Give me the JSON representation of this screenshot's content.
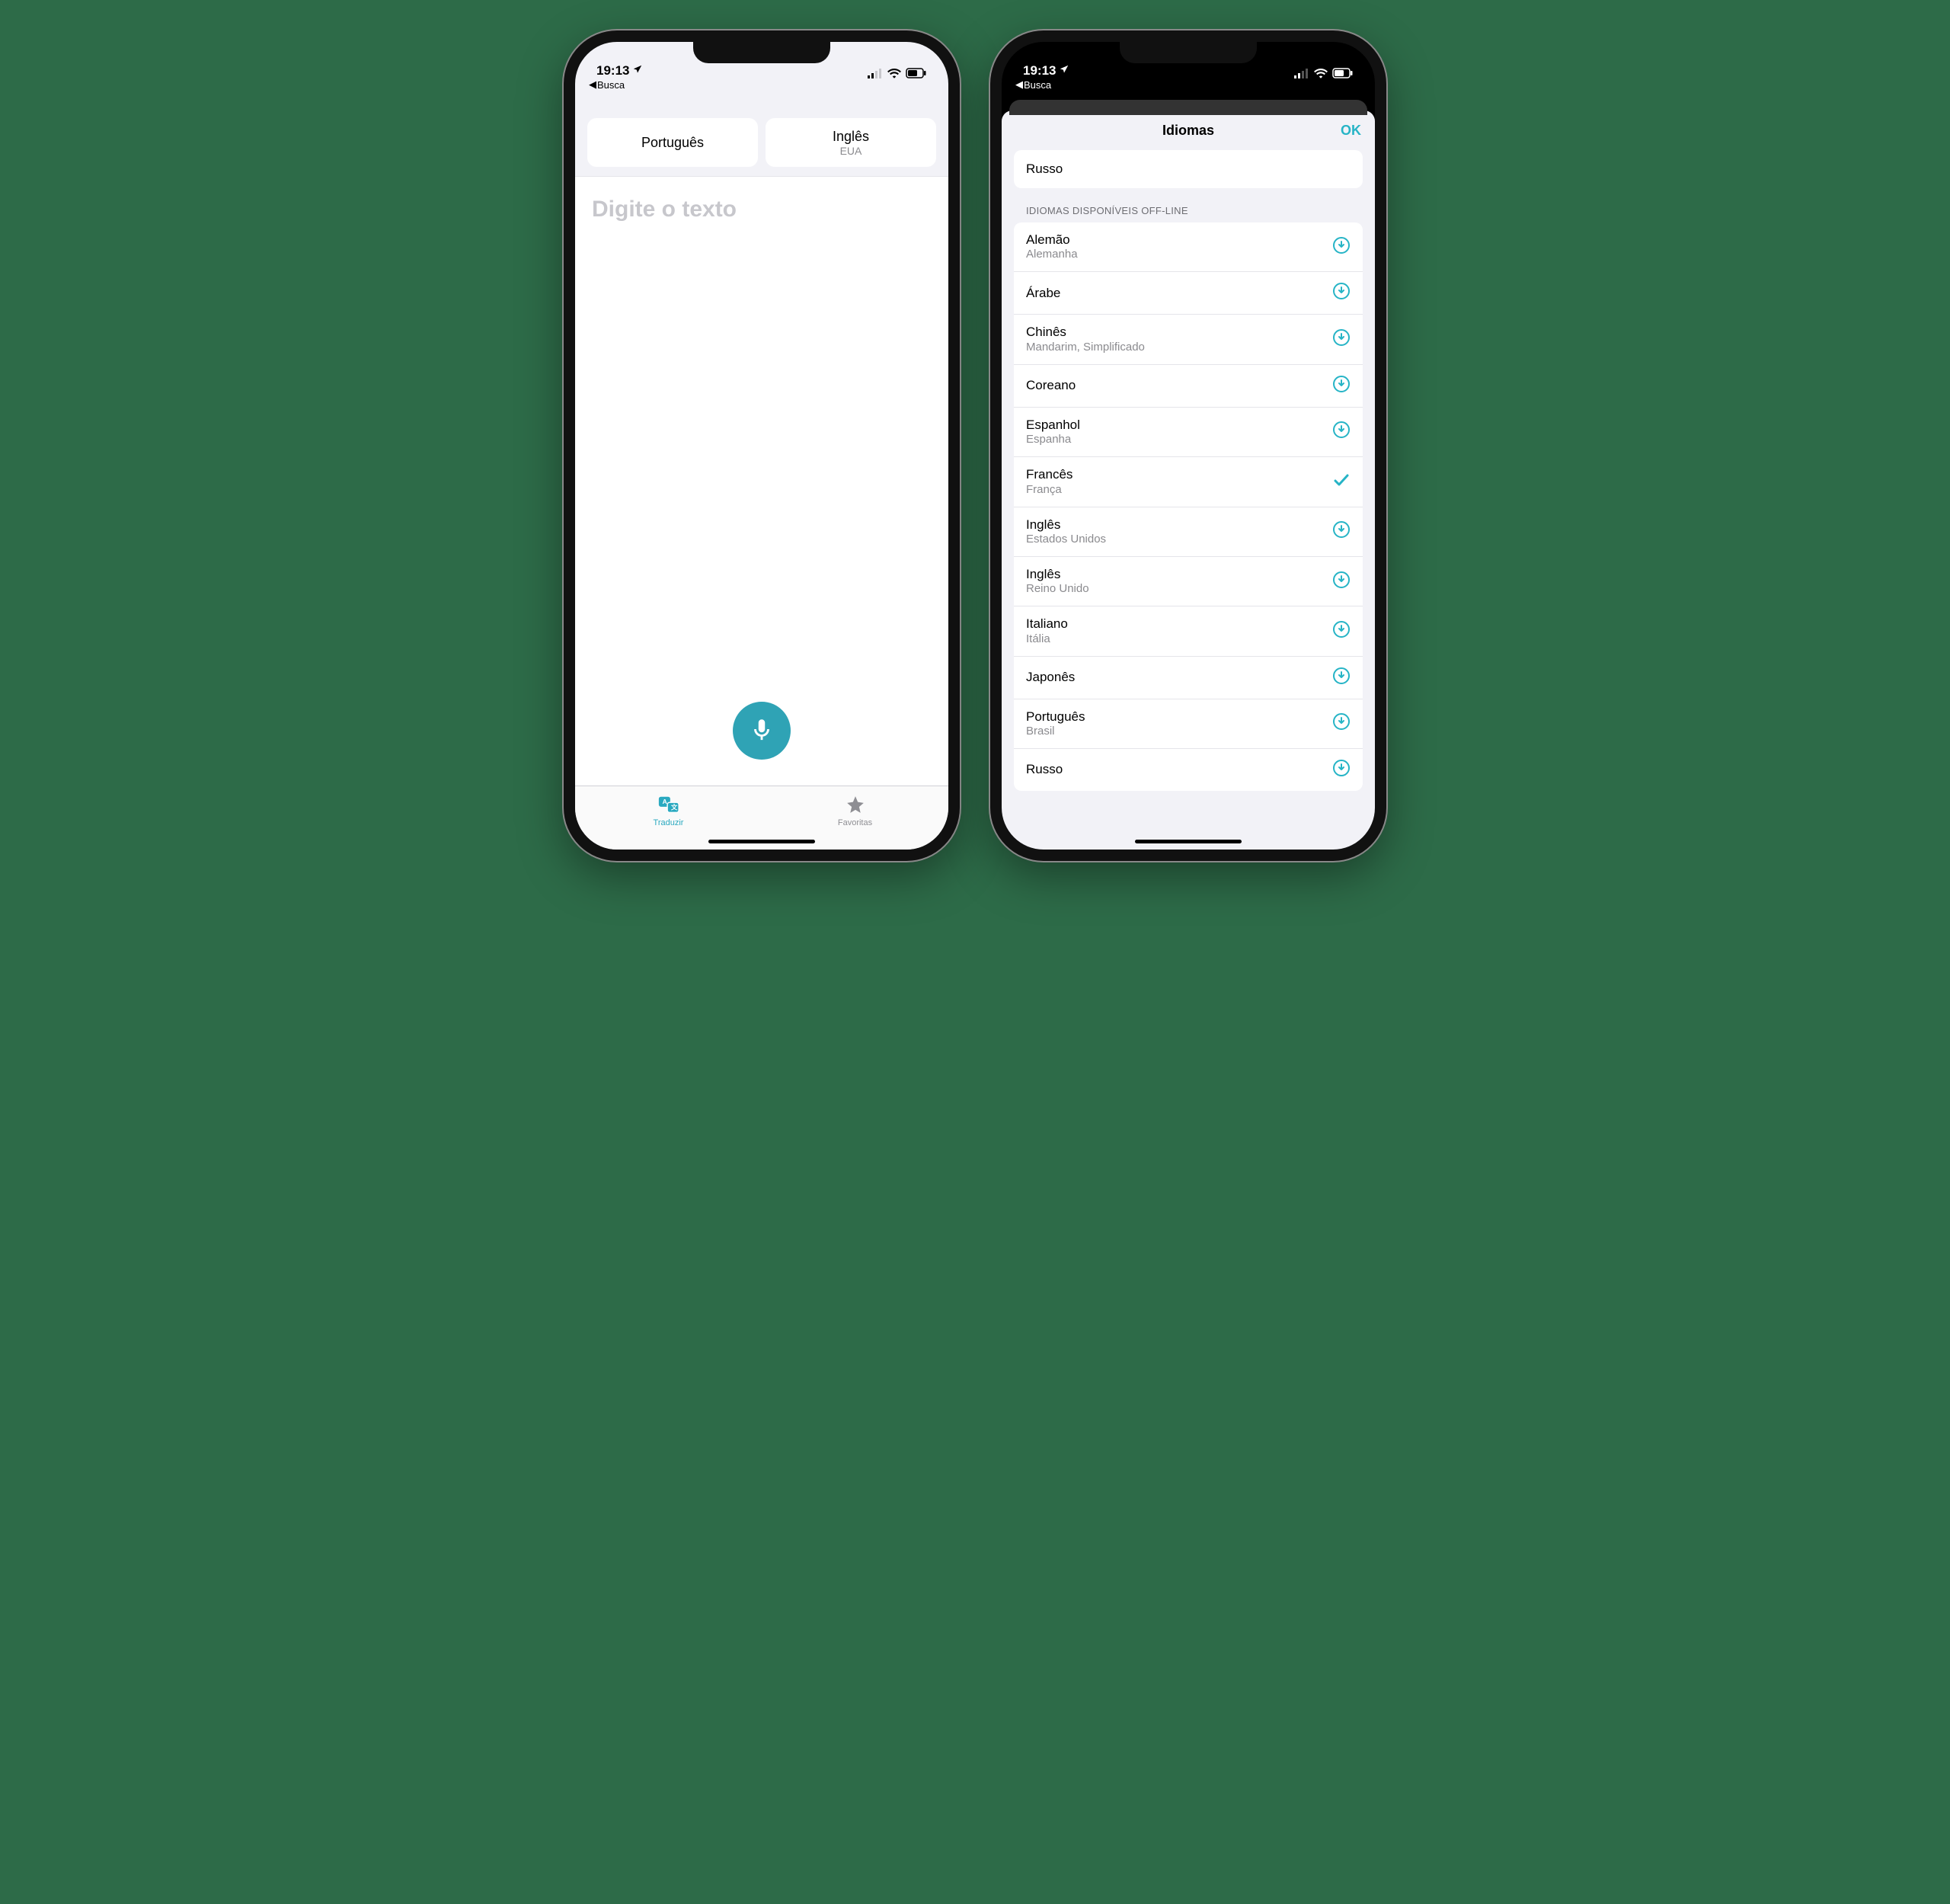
{
  "status": {
    "time": "19:13",
    "back_label": "Busca"
  },
  "left": {
    "lang_from": {
      "label": "Português",
      "sub": ""
    },
    "lang_to": {
      "label": "Inglês",
      "sub": "EUA"
    },
    "placeholder": "Digite o texto",
    "tabs": {
      "translate": "Traduzir",
      "favorites": "Favoritas"
    }
  },
  "right": {
    "sheet_title": "Idiomas",
    "sheet_ok": "OK",
    "top_item": {
      "label": "Russo"
    },
    "section_label": "IDIOMAS DISPONÍVEIS OFF-LINE",
    "languages": [
      {
        "label": "Alemão",
        "sub": "Alemanha",
        "state": "download"
      },
      {
        "label": "Árabe",
        "sub": "",
        "state": "download"
      },
      {
        "label": "Chinês",
        "sub": "Mandarim, Simplificado",
        "state": "download"
      },
      {
        "label": "Coreano",
        "sub": "",
        "state": "download"
      },
      {
        "label": "Espanhol",
        "sub": "Espanha",
        "state": "download"
      },
      {
        "label": "Francês",
        "sub": "França",
        "state": "check"
      },
      {
        "label": "Inglês",
        "sub": "Estados Unidos",
        "state": "download"
      },
      {
        "label": "Inglês",
        "sub": "Reino Unido",
        "state": "download"
      },
      {
        "label": "Italiano",
        "sub": "Itália",
        "state": "download"
      },
      {
        "label": "Japonês",
        "sub": "",
        "state": "download"
      },
      {
        "label": "Português",
        "sub": "Brasil",
        "state": "download"
      },
      {
        "label": "Russo",
        "sub": "",
        "state": "download"
      }
    ]
  },
  "colors": {
    "accent": "#26b4c6"
  }
}
